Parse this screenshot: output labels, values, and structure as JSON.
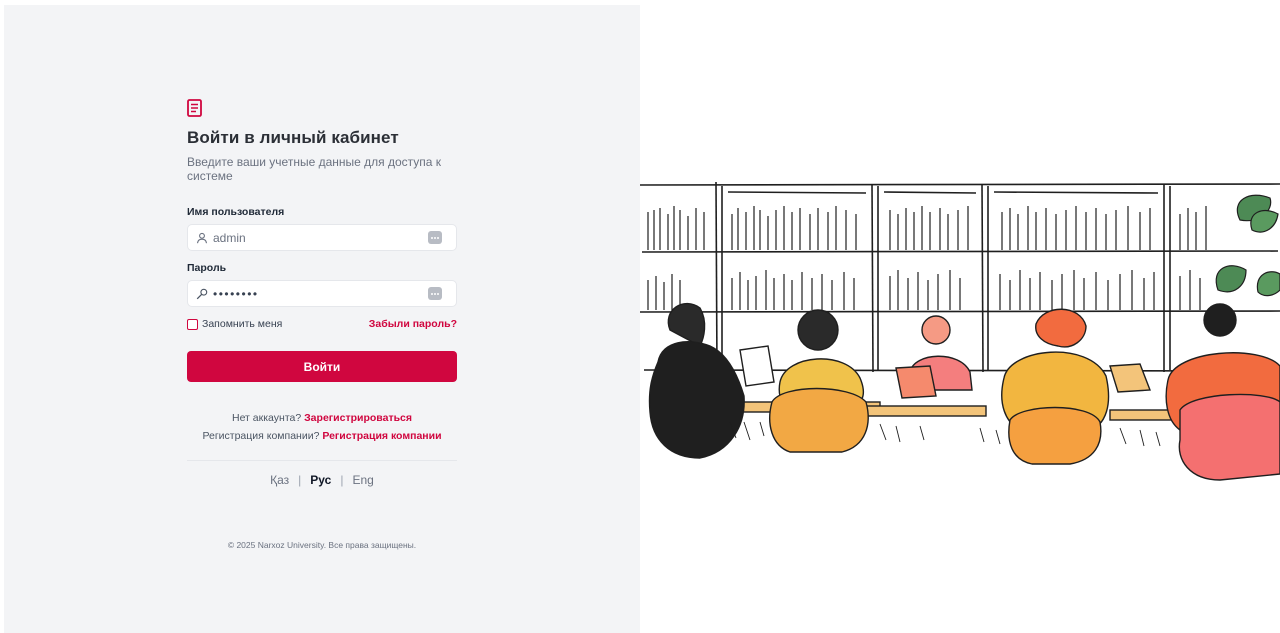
{
  "login": {
    "title": "Войти в личный кабинет",
    "subtitle": "Введите ваши учетные данные для доступа к системе",
    "username": {
      "label": "Имя пользователя",
      "placeholder": "admin",
      "icon": "user-icon"
    },
    "password": {
      "label": "Пароль",
      "value": "••••••••",
      "icon": "key-icon"
    },
    "remember_label": "Запомнить меня",
    "remember_checked": false,
    "forgot_label": "Забыли пароль?",
    "submit_label": "Войти"
  },
  "links": {
    "no_account_text": "Нет аккаунта?",
    "register_link": "Зарегистрироваться",
    "company_text": "Регистрация компании?",
    "company_link": "Регистрация компании"
  },
  "languages": {
    "kz": "Қаз",
    "ru": "Рус",
    "en": "Eng",
    "active": "ru"
  },
  "footer": {
    "copyright": "© 2025 Narxoz University. Все права защищены."
  },
  "colors": {
    "accent": "#d0063f",
    "panel_bg": "#f3f4f6"
  },
  "icons": {
    "logo": "book-icon"
  }
}
